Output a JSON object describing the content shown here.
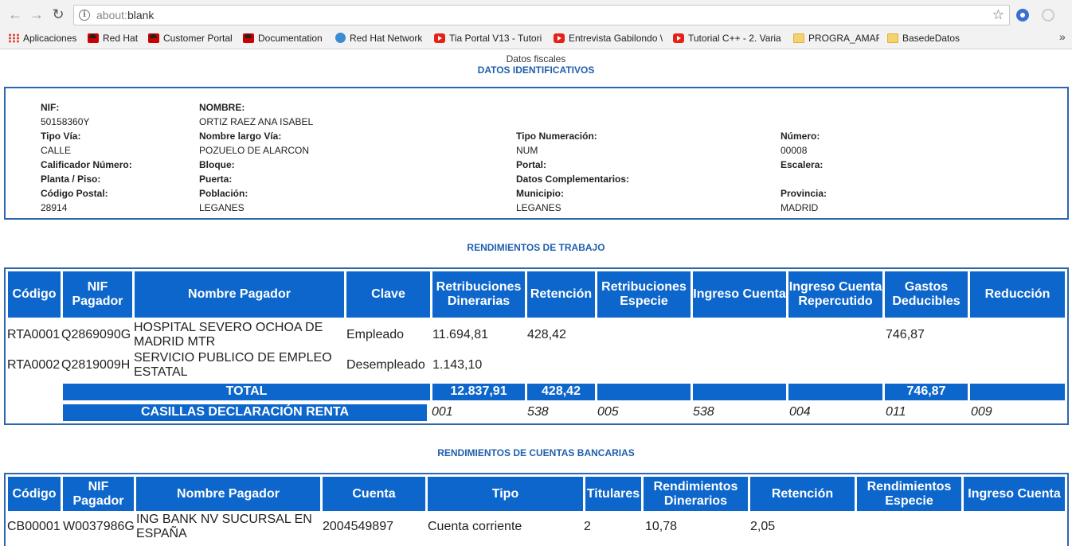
{
  "browser": {
    "url_prefix": "about:",
    "url_rest": "blank",
    "bookmarks": [
      {
        "label": "Aplicaciones",
        "icon": "apps-icon"
      },
      {
        "label": "Red Hat",
        "icon": "redhat-icon"
      },
      {
        "label": "Customer Portal",
        "icon": "redhat-icon"
      },
      {
        "label": "Documentation",
        "icon": "redhat-icon"
      },
      {
        "label": "Red Hat Network",
        "icon": "globe-icon"
      },
      {
        "label": "Tia Portal V13 - Tutori",
        "icon": "youtube-icon"
      },
      {
        "label": "Entrevista Gabilondo \\",
        "icon": "youtube-icon"
      },
      {
        "label": "Tutorial C++ - 2. Varia",
        "icon": "youtube-icon"
      },
      {
        "label": "PROGRA_AMAR",
        "icon": "folder-icon"
      },
      {
        "label": "BasedeDatos",
        "icon": "folder-icon"
      }
    ],
    "overflow": "»"
  },
  "page": {
    "title": "Datos fiscales",
    "ident_heading": "DATOS IDENTIFICATIVOS",
    "ident": {
      "nif_label": "NIF:",
      "nif": "50158360Y",
      "nombre_label": "NOMBRE:",
      "nombre": "ORTIZ RAEZ ANA ISABEL",
      "tipo_via_label": "Tipo Vía:",
      "tipo_via": "CALLE",
      "nombre_via_label": "Nombre largo Vía:",
      "nombre_via": "POZUELO DE ALARCON",
      "tipo_num_label": "Tipo Numeración:",
      "tipo_num": "NUM",
      "numero_label": "Número:",
      "numero": "00008",
      "calificador_label": "Calificador Número:",
      "bloque_label": "Bloque:",
      "portal_label": "Portal:",
      "escalera_label": "Escalera:",
      "planta_label": "Planta / Piso:",
      "puerta_label": "Puerta:",
      "datos_comp_label": "Datos Complementarios:",
      "cp_label": "Código Postal:",
      "cp": "28914",
      "poblacion_label": "Población:",
      "poblacion": "LEGANES",
      "municipio_label": "Municipio:",
      "municipio": "LEGANES",
      "provincia_label": "Provincia:",
      "provincia": "MADRID"
    },
    "trabajo_heading": "RENDIMIENTOS DE TRABAJO",
    "trabajo": {
      "headers": [
        "Código",
        "NIF Pagador",
        "Nombre Pagador",
        "Clave",
        "Retribuciones Dinerarias",
        "Retención",
        "Retribuciones Especie",
        "Ingreso Cuenta",
        "Ingreso Cuenta Repercutido",
        "Gastos Deducibles",
        "Reducción"
      ],
      "rows": [
        [
          "RTA0001",
          "Q2869090G",
          "HOSPITAL SEVERO OCHOA DE MADRID MTR",
          "Empleado",
          "11.694,81",
          "428,42",
          "",
          "",
          "",
          "746,87",
          ""
        ],
        [
          "RTA0002",
          "Q2819009H",
          "SERVICIO PUBLICO DE EMPLEO ESTATAL",
          "Desempleado",
          "1.143,10",
          "",
          "",
          "",
          "",
          "",
          ""
        ]
      ],
      "total_label": "TOTAL",
      "totals": [
        "12.837,91",
        "428,42",
        "",
        "",
        "",
        "746,87",
        ""
      ],
      "casillas_label": "CASILLAS DECLARACIÓN RENTA",
      "casillas": [
        "001",
        "538",
        "005",
        "538",
        "004",
        "011",
        "009"
      ]
    },
    "cuentas_heading": "RENDIMIENTOS DE CUENTAS BANCARIAS",
    "cuentas": {
      "headers": [
        "Código",
        "NIF Pagador",
        "Nombre Pagador",
        "Cuenta",
        "Tipo",
        "Titulares",
        "Rendimientos Dinerarios",
        "Retención",
        "Rendimientos Especie",
        "Ingreso Cuenta"
      ],
      "rows": [
        [
          "CB00001",
          "W0037986G",
          "ING BANK NV SUCURSAL EN ESPAÑA",
          "2004549897",
          "Cuenta corriente",
          "2",
          "10,78",
          "2,05",
          "",
          ""
        ]
      ]
    }
  }
}
